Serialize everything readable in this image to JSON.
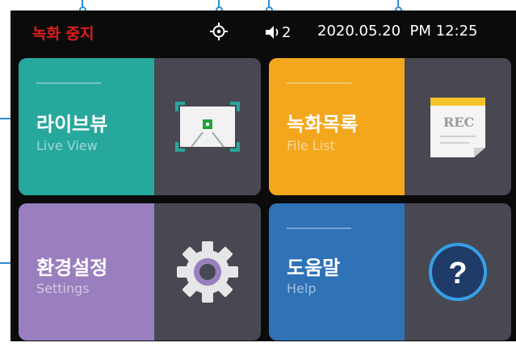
{
  "status": {
    "record_stop_label": "녹화 중지",
    "volume_level": "2",
    "datetime": "2020.05.20  PM 12:25",
    "icons": {
      "gps": "gps-target-icon",
      "volume": "speaker-icon"
    },
    "record_stop_color": "#e11b1b"
  },
  "tiles": [
    {
      "title": "라이브뷰",
      "subtitle": "Live View",
      "color": "#27a89d",
      "icon": "live-view-camera-icon"
    },
    {
      "title": "녹화목록",
      "subtitle": "File List",
      "color": "#f3a71c",
      "icon": "rec-file-icon",
      "icon_text": "REC"
    },
    {
      "title": "환경설정",
      "subtitle": "Settings",
      "color": "#9a7fbf",
      "icon": "gear-icon"
    },
    {
      "title": "도움말",
      "subtitle": "Help",
      "color": "#2f72b6",
      "icon": "help-question-icon",
      "icon_text": "?"
    }
  ],
  "callout_color": "#2f8ed0"
}
